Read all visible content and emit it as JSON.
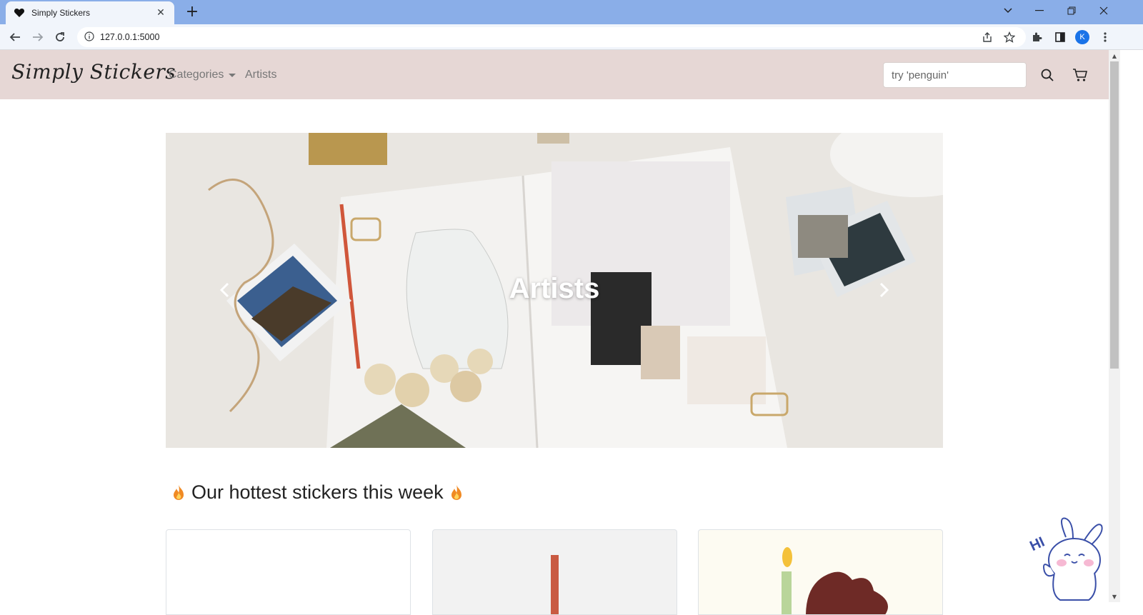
{
  "browser": {
    "tab_title": "Simply Stickers",
    "url": "127.0.0.1:5000",
    "profile_initial": "K"
  },
  "header": {
    "brand": "Simply Stickers",
    "nav": {
      "categories": "Categories",
      "artists": "Artists"
    },
    "search_placeholder": "try 'penguin'"
  },
  "carousel": {
    "caption": "Artists"
  },
  "main": {
    "hot_heading": "Our hottest stickers this week"
  },
  "mascot": {
    "text": "HI"
  },
  "colors": {
    "tabbar": "#8aaee8",
    "header_bg": "#e6d7d5",
    "brand_text": "#222222",
    "nav_text": "#777777"
  }
}
